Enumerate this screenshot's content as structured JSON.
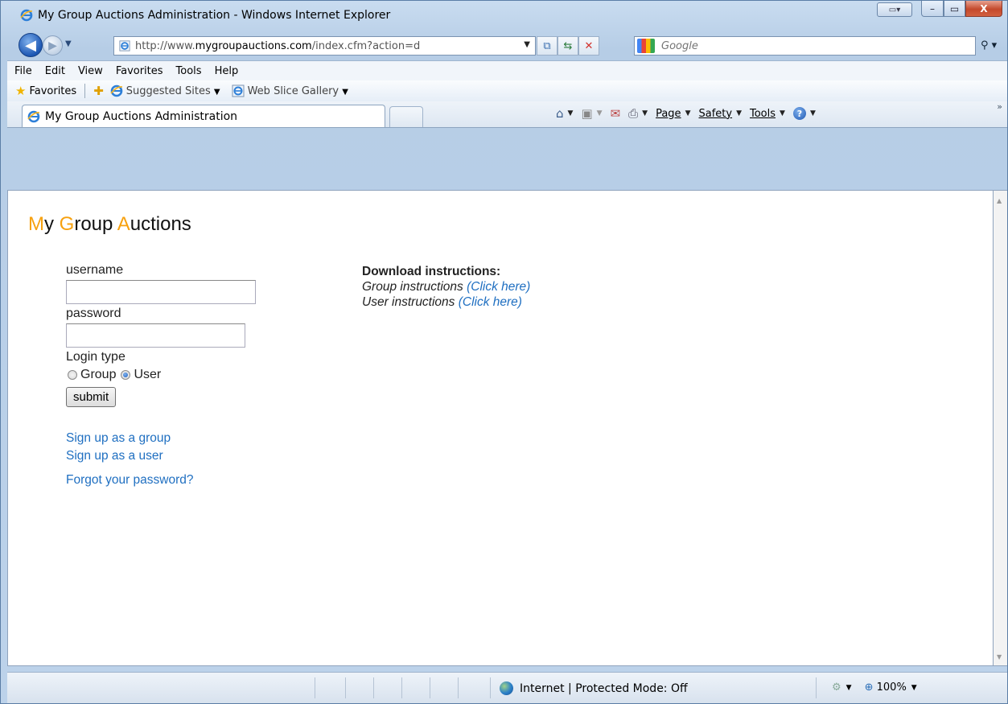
{
  "window": {
    "title": "My Group Auctions Administration - Windows Internet Explorer",
    "minimize_glyph": "–",
    "maximize_glyph": "▭",
    "close_glyph": "X",
    "compat_glyph": "▭▾"
  },
  "address_bar": {
    "url_prefix": "http://www.",
    "url_domain": "mygroupauctions.com",
    "url_rest": "/index.cfm?action=d",
    "search_placeholder": "Google"
  },
  "menu": [
    {
      "label": "File"
    },
    {
      "label": "Edit"
    },
    {
      "label": "View"
    },
    {
      "label": "Favorites"
    },
    {
      "label": "Tools"
    },
    {
      "label": "Help"
    }
  ],
  "favorites_bar": {
    "favorites_label": "Favorites",
    "suggested_sites": "Suggested Sites",
    "web_slice_gallery": "Web Slice Gallery"
  },
  "tab": {
    "title": "My Group Auctions Administration"
  },
  "command_bar": {
    "page": "Page",
    "safety": "Safety",
    "tools": "Tools"
  },
  "page": {
    "title_parts": [
      {
        "accent": "M",
        "rest": "y "
      },
      {
        "accent": "G",
        "rest": "roup "
      },
      {
        "accent": "A",
        "rest": "uctions"
      }
    ],
    "form": {
      "username_label": "username",
      "username_value": "",
      "password_label": "password",
      "password_value": "",
      "login_type_label": "Login type",
      "option_group": "Group",
      "option_user": "User",
      "selected": "User",
      "submit_label": "submit"
    },
    "links": {
      "signup_group": "Sign up as a group",
      "signup_user": "Sign up as a user",
      "forgot_password": "Forgot your password?"
    },
    "instructions": {
      "heading": "Download instructions:",
      "group_text": "Group instructions ",
      "group_link": "(Click here)",
      "user_text": "User instructions ",
      "user_link": "(Click here)"
    }
  },
  "status_bar": {
    "zone": "Internet | Protected Mode: Off",
    "zoom": "100%"
  },
  "colors": {
    "title_accent": "#f7a10f",
    "link": "#1f6fc1"
  }
}
